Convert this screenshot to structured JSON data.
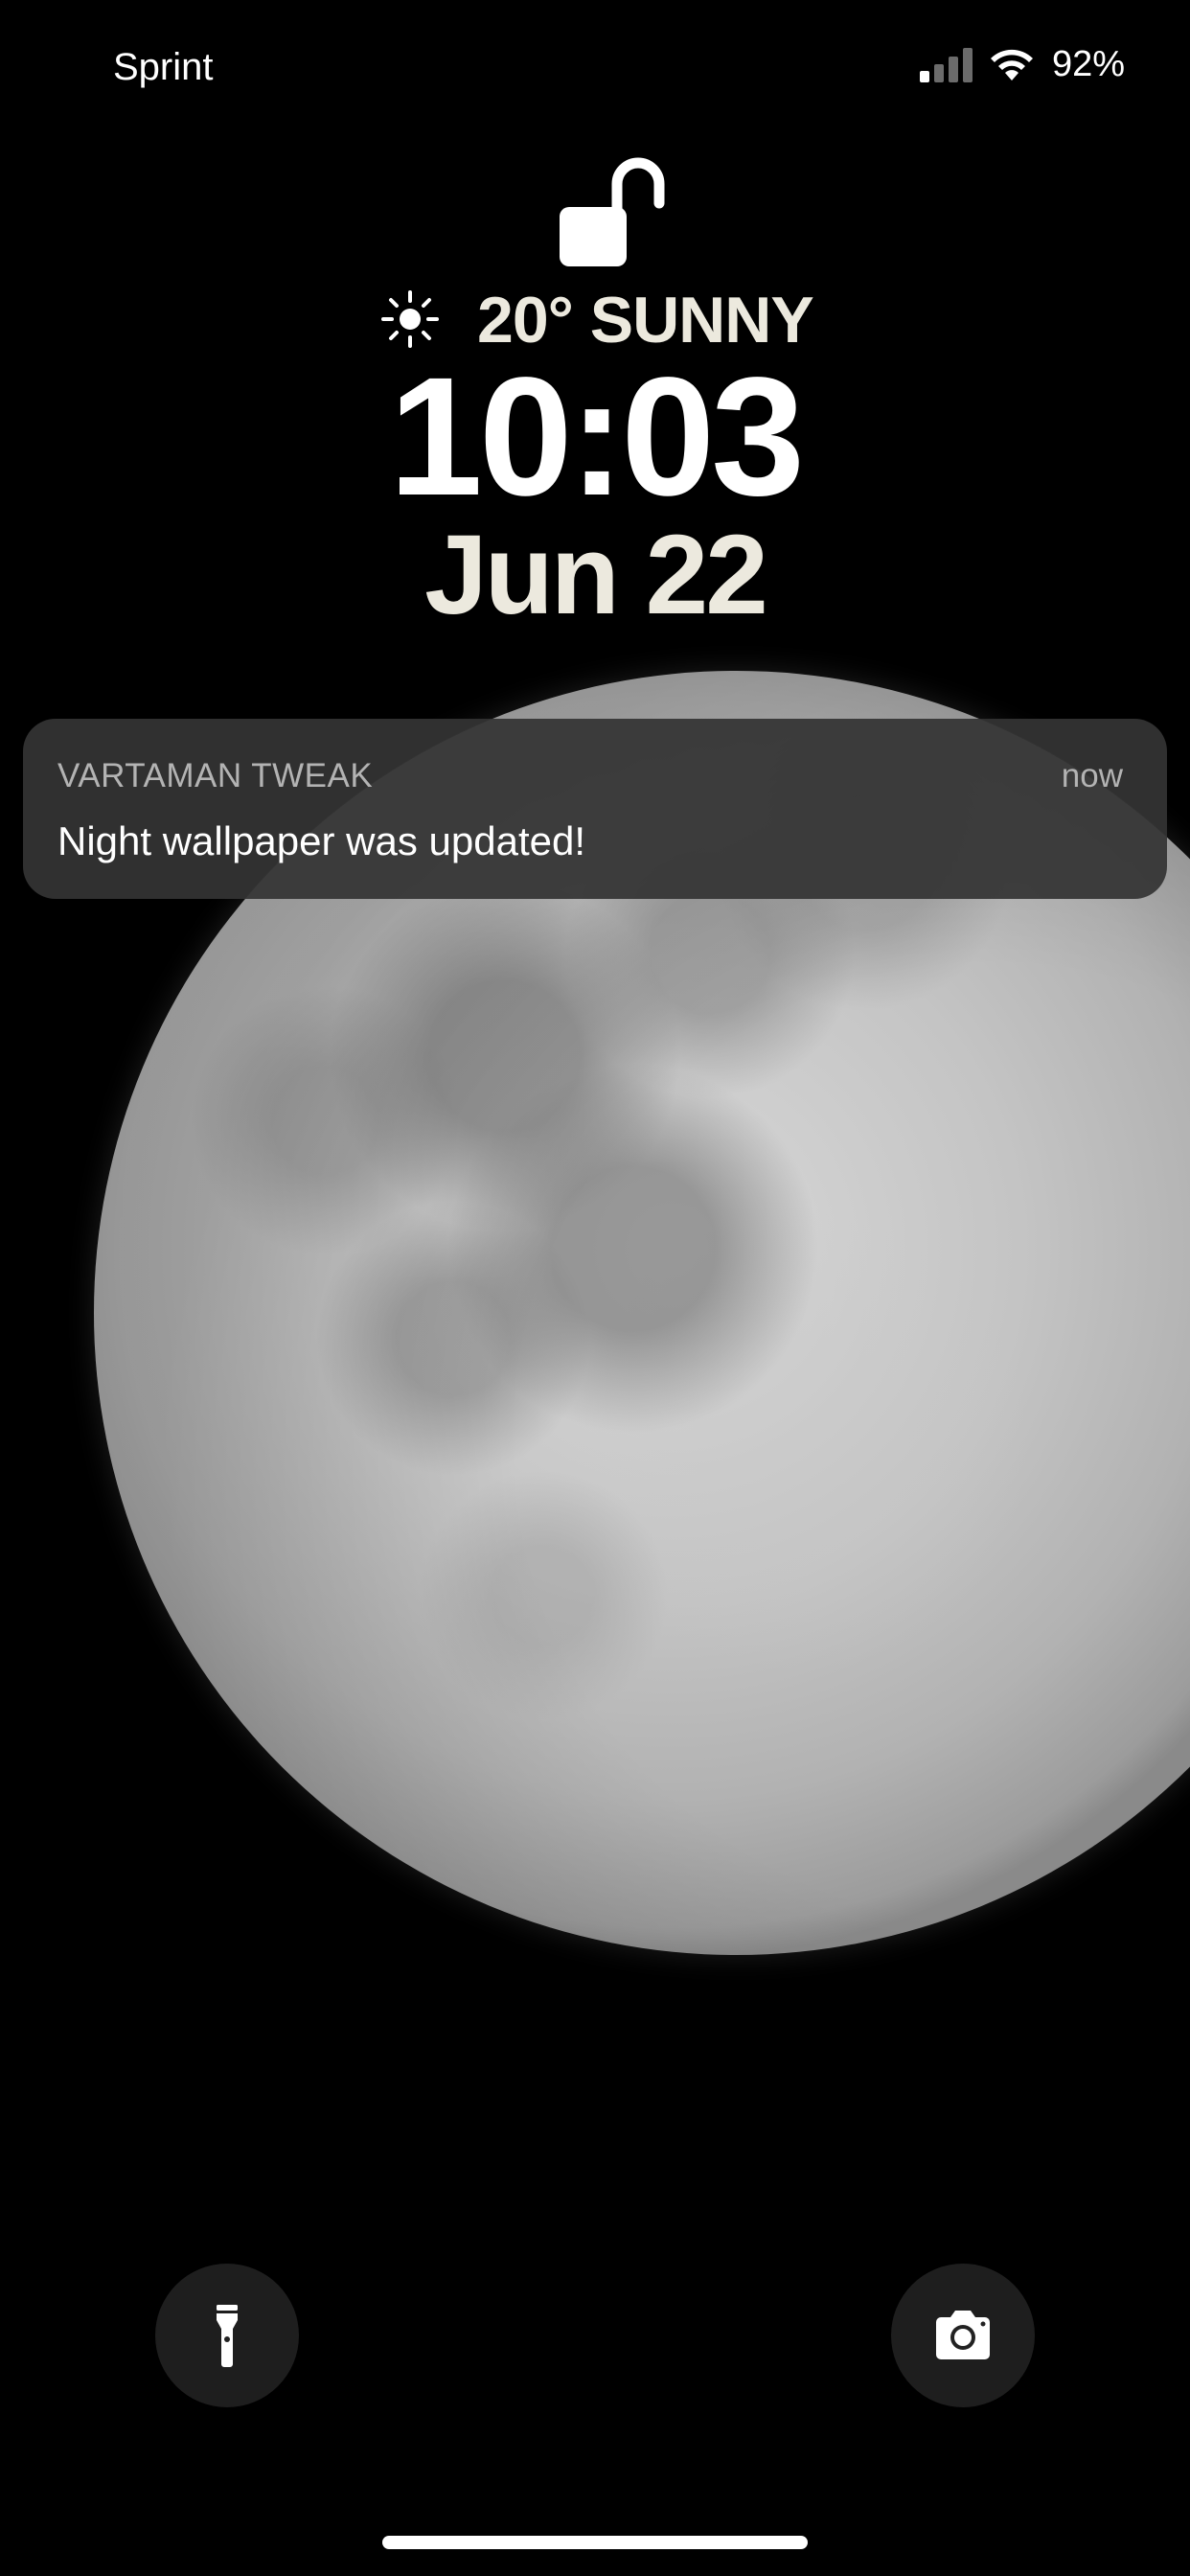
{
  "status_bar": {
    "carrier": "Sprint",
    "battery": "92%",
    "signal_bars_active": 1,
    "signal_bars_total": 4,
    "signal_icon": "cellular-signal-icon",
    "wifi_icon": "wifi-icon"
  },
  "lock": {
    "icon": "unlocked-padlock-icon",
    "weather_icon": "sun-icon",
    "weather": "20° SUNNY",
    "time": "10:03",
    "date": "Jun 22"
  },
  "notification": {
    "app": "VARTAMAN TWEAK",
    "time": "now",
    "message": "Night wallpaper was updated!"
  },
  "quick_actions": {
    "flashlight_icon": "flashlight-icon",
    "camera_icon": "camera-icon"
  },
  "colors": {
    "background": "#000000",
    "notification_bg": "#343434",
    "accent_text": "#ece9de",
    "signal_active": "#ffffff",
    "signal_inactive": "#6b6b6b"
  }
}
